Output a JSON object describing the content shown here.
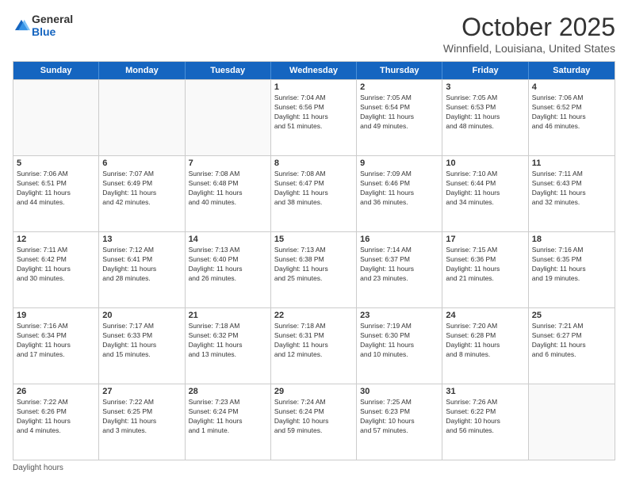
{
  "header": {
    "logo_general": "General",
    "logo_blue": "Blue",
    "month_title": "October 2025",
    "location": "Winnfield, Louisiana, United States"
  },
  "days_of_week": [
    "Sunday",
    "Monday",
    "Tuesday",
    "Wednesday",
    "Thursday",
    "Friday",
    "Saturday"
  ],
  "weeks": [
    [
      {
        "day": "",
        "info": ""
      },
      {
        "day": "",
        "info": ""
      },
      {
        "day": "",
        "info": ""
      },
      {
        "day": "1",
        "info": "Sunrise: 7:04 AM\nSunset: 6:56 PM\nDaylight: 11 hours\nand 51 minutes."
      },
      {
        "day": "2",
        "info": "Sunrise: 7:05 AM\nSunset: 6:54 PM\nDaylight: 11 hours\nand 49 minutes."
      },
      {
        "day": "3",
        "info": "Sunrise: 7:05 AM\nSunset: 6:53 PM\nDaylight: 11 hours\nand 48 minutes."
      },
      {
        "day": "4",
        "info": "Sunrise: 7:06 AM\nSunset: 6:52 PM\nDaylight: 11 hours\nand 46 minutes."
      }
    ],
    [
      {
        "day": "5",
        "info": "Sunrise: 7:06 AM\nSunset: 6:51 PM\nDaylight: 11 hours\nand 44 minutes."
      },
      {
        "day": "6",
        "info": "Sunrise: 7:07 AM\nSunset: 6:49 PM\nDaylight: 11 hours\nand 42 minutes."
      },
      {
        "day": "7",
        "info": "Sunrise: 7:08 AM\nSunset: 6:48 PM\nDaylight: 11 hours\nand 40 minutes."
      },
      {
        "day": "8",
        "info": "Sunrise: 7:08 AM\nSunset: 6:47 PM\nDaylight: 11 hours\nand 38 minutes."
      },
      {
        "day": "9",
        "info": "Sunrise: 7:09 AM\nSunset: 6:46 PM\nDaylight: 11 hours\nand 36 minutes."
      },
      {
        "day": "10",
        "info": "Sunrise: 7:10 AM\nSunset: 6:44 PM\nDaylight: 11 hours\nand 34 minutes."
      },
      {
        "day": "11",
        "info": "Sunrise: 7:11 AM\nSunset: 6:43 PM\nDaylight: 11 hours\nand 32 minutes."
      }
    ],
    [
      {
        "day": "12",
        "info": "Sunrise: 7:11 AM\nSunset: 6:42 PM\nDaylight: 11 hours\nand 30 minutes."
      },
      {
        "day": "13",
        "info": "Sunrise: 7:12 AM\nSunset: 6:41 PM\nDaylight: 11 hours\nand 28 minutes."
      },
      {
        "day": "14",
        "info": "Sunrise: 7:13 AM\nSunset: 6:40 PM\nDaylight: 11 hours\nand 26 minutes."
      },
      {
        "day": "15",
        "info": "Sunrise: 7:13 AM\nSunset: 6:38 PM\nDaylight: 11 hours\nand 25 minutes."
      },
      {
        "day": "16",
        "info": "Sunrise: 7:14 AM\nSunset: 6:37 PM\nDaylight: 11 hours\nand 23 minutes."
      },
      {
        "day": "17",
        "info": "Sunrise: 7:15 AM\nSunset: 6:36 PM\nDaylight: 11 hours\nand 21 minutes."
      },
      {
        "day": "18",
        "info": "Sunrise: 7:16 AM\nSunset: 6:35 PM\nDaylight: 11 hours\nand 19 minutes."
      }
    ],
    [
      {
        "day": "19",
        "info": "Sunrise: 7:16 AM\nSunset: 6:34 PM\nDaylight: 11 hours\nand 17 minutes."
      },
      {
        "day": "20",
        "info": "Sunrise: 7:17 AM\nSunset: 6:33 PM\nDaylight: 11 hours\nand 15 minutes."
      },
      {
        "day": "21",
        "info": "Sunrise: 7:18 AM\nSunset: 6:32 PM\nDaylight: 11 hours\nand 13 minutes."
      },
      {
        "day": "22",
        "info": "Sunrise: 7:18 AM\nSunset: 6:31 PM\nDaylight: 11 hours\nand 12 minutes."
      },
      {
        "day": "23",
        "info": "Sunrise: 7:19 AM\nSunset: 6:30 PM\nDaylight: 11 hours\nand 10 minutes."
      },
      {
        "day": "24",
        "info": "Sunrise: 7:20 AM\nSunset: 6:28 PM\nDaylight: 11 hours\nand 8 minutes."
      },
      {
        "day": "25",
        "info": "Sunrise: 7:21 AM\nSunset: 6:27 PM\nDaylight: 11 hours\nand 6 minutes."
      }
    ],
    [
      {
        "day": "26",
        "info": "Sunrise: 7:22 AM\nSunset: 6:26 PM\nDaylight: 11 hours\nand 4 minutes."
      },
      {
        "day": "27",
        "info": "Sunrise: 7:22 AM\nSunset: 6:25 PM\nDaylight: 11 hours\nand 3 minutes."
      },
      {
        "day": "28",
        "info": "Sunrise: 7:23 AM\nSunset: 6:24 PM\nDaylight: 11 hours\nand 1 minute."
      },
      {
        "day": "29",
        "info": "Sunrise: 7:24 AM\nSunset: 6:24 PM\nDaylight: 10 hours\nand 59 minutes."
      },
      {
        "day": "30",
        "info": "Sunrise: 7:25 AM\nSunset: 6:23 PM\nDaylight: 10 hours\nand 57 minutes."
      },
      {
        "day": "31",
        "info": "Sunrise: 7:26 AM\nSunset: 6:22 PM\nDaylight: 10 hours\nand 56 minutes."
      },
      {
        "day": "",
        "info": ""
      }
    ]
  ],
  "footer": {
    "note": "Daylight hours"
  }
}
